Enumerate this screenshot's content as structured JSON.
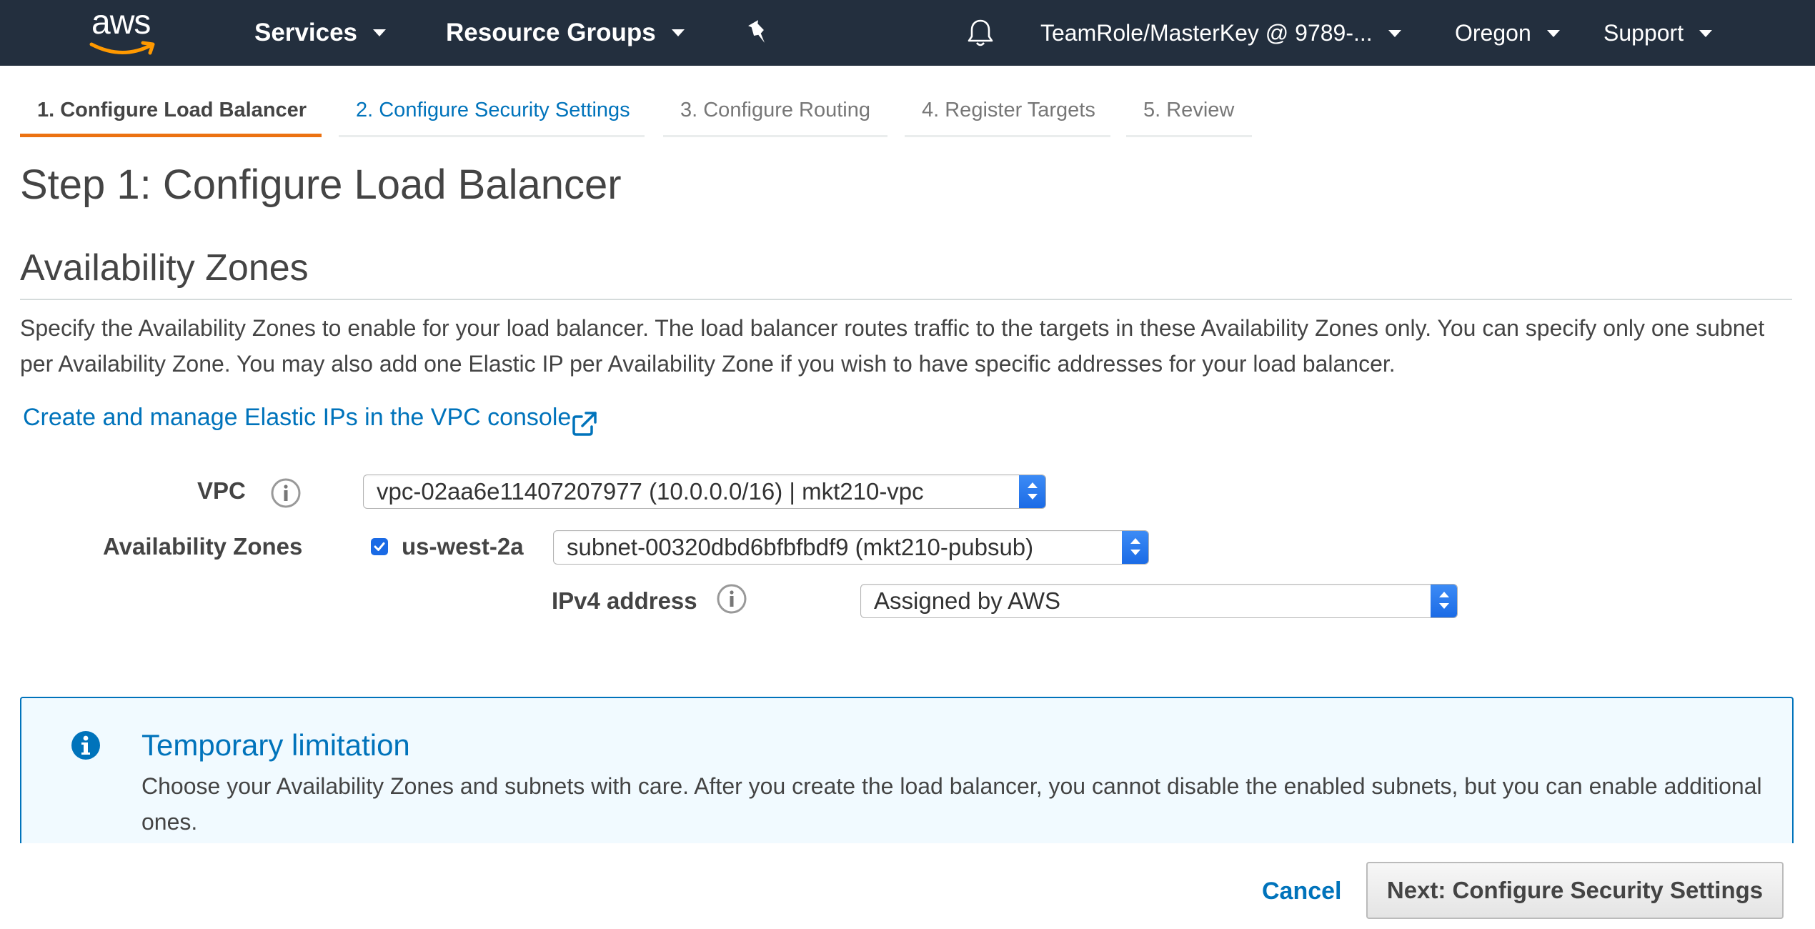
{
  "nav": {
    "brand": "aws",
    "services": "Services",
    "resource_groups": "Resource Groups",
    "account": "TeamRole/MasterKey @ 9789-...",
    "region": "Oregon",
    "support": "Support",
    "colors": {
      "bar": "#232f3e",
      "accent": "#ff9900"
    }
  },
  "wizard": {
    "tabs": [
      {
        "label": "1. Configure Load Balancer",
        "state": "active"
      },
      {
        "label": "2. Configure Security Settings",
        "state": "link"
      },
      {
        "label": "3. Configure Routing",
        "state": "disabled"
      },
      {
        "label": "4. Register Targets",
        "state": "disabled"
      },
      {
        "label": "5. Review",
        "state": "disabled"
      }
    ]
  },
  "page": {
    "title": "Step 1: Configure Load Balancer",
    "section_title": "Availability Zones",
    "description": "Specify the Availability Zones to enable for your load balancer. The load balancer routes traffic to the targets in these Availability Zones only. You can specify only one subnet per Availability Zone. You may also add one Elastic IP per Availability Zone if you wish to have specific addresses for your load balancer.",
    "vpc_link": "Create and manage Elastic IPs in the VPC console"
  },
  "form": {
    "vpc_label": "VPC",
    "vpc_value": "vpc-02aa6e11407207977 (10.0.0.0/16) | mkt210-vpc",
    "az_label": "Availability Zones",
    "az_zone": "us-west-2a",
    "az_checked": true,
    "subnet_value": "subnet-00320dbd6bfbfbdf9 (mkt210-pubsub)",
    "ipv4_label": "IPv4 address",
    "ipv4_value": "Assigned by AWS"
  },
  "alert": {
    "title": "Temporary limitation",
    "body": "Choose your Availability Zones and subnets with care. After you create the load balancer, you cannot disable the enabled subnets, but you can enable additional ones."
  },
  "footer": {
    "cancel": "Cancel",
    "next": "Next: Configure Security Settings"
  }
}
